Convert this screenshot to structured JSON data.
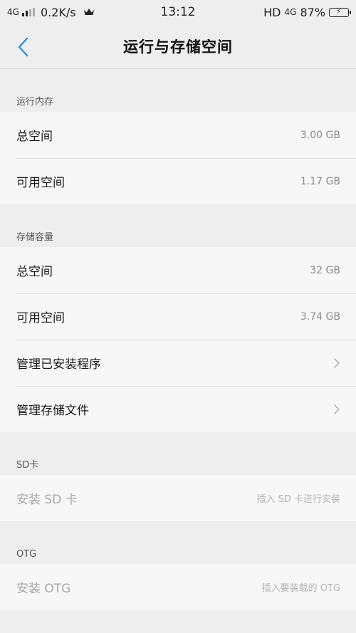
{
  "status_bar": {
    "network_left": "4G",
    "speed": "0.2K/s",
    "time": "13:12",
    "hd": "HD",
    "network_right": "4G",
    "battery": "87%"
  },
  "header": {
    "title": "运行与存储空间"
  },
  "sections": {
    "ram": {
      "header": "运行内存",
      "total_label": "总空间",
      "total_value": "3.00 GB",
      "available_label": "可用空间",
      "available_value": "1.17 GB"
    },
    "storage": {
      "header": "存储容量",
      "total_label": "总空间",
      "total_value": "32 GB",
      "available_label": "可用空间",
      "available_value": "3.74 GB",
      "manage_apps_label": "管理已安装程序",
      "manage_files_label": "管理存储文件"
    },
    "sd": {
      "header": "SD卡",
      "install_label": "安装 SD 卡",
      "install_hint": "插入 SD 卡进行安装"
    },
    "otg": {
      "header": "OTG",
      "install_label": "安装 OTG",
      "install_hint": "插入要装载的 OTG"
    }
  },
  "colors": {
    "accent": "#2f8fe0",
    "background": "#eeeeee",
    "card": "#f7f7f7"
  },
  "icons": {
    "back": "chevron-left-icon",
    "row_arrow": "chevron-right-icon",
    "crown": "crown-icon",
    "battery": "battery-charging-icon"
  }
}
